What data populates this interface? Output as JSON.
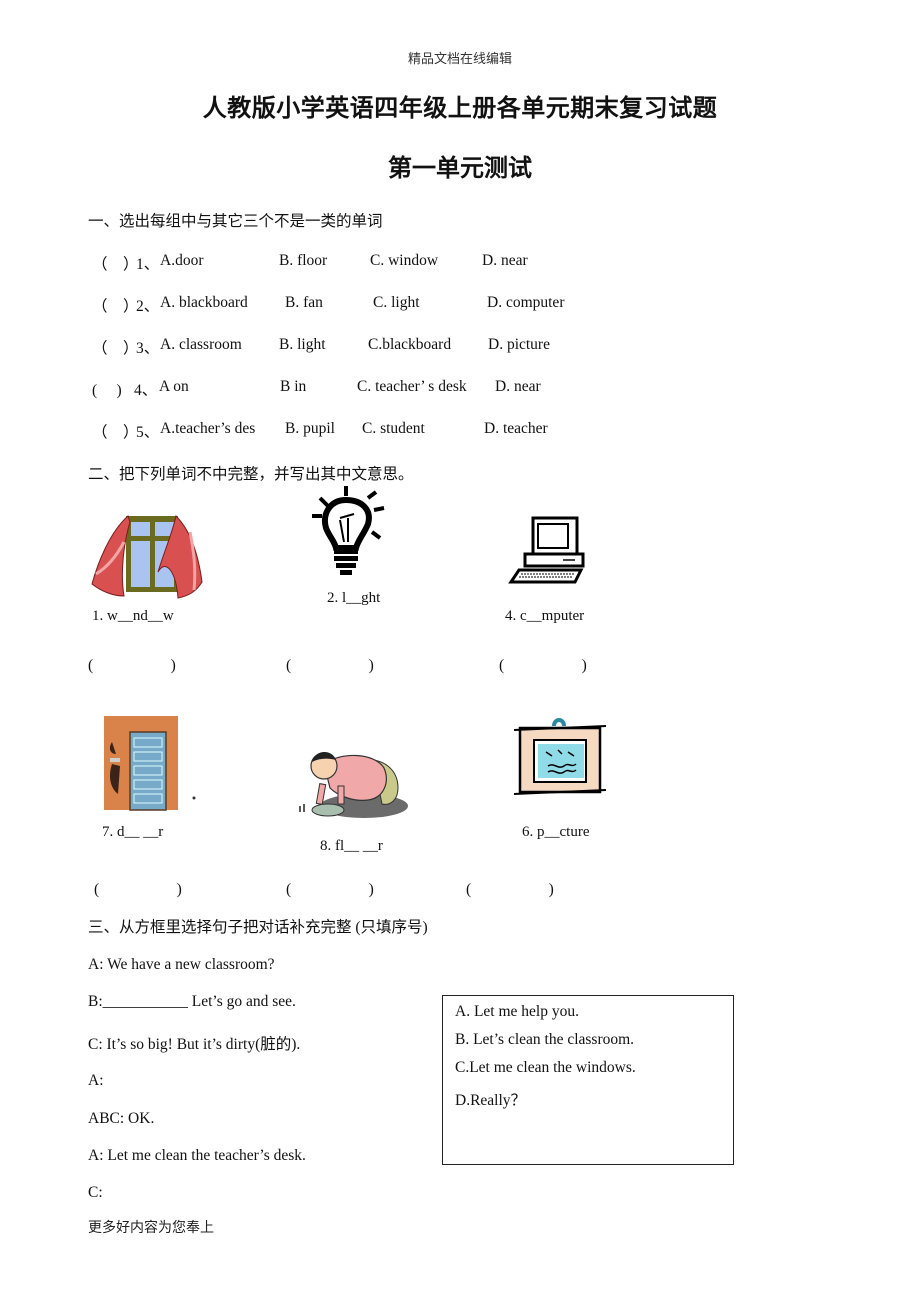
{
  "header_note": "精品文档在线编辑",
  "title": "人教版小学英语四年级上册各单元期末复习试题",
  "unit_title": "第一单元测试",
  "section1": {
    "heading": "一、选出每组中与其它三个不是一类的单词",
    "questions": [
      {
        "bracket": "（　）",
        "num": "1、",
        "a": "A.door",
        "b": "B. floor",
        "c": "C. window",
        "d": "D. near"
      },
      {
        "bracket": "（　）",
        "num": "2、",
        "a": "A. blackboard",
        "b": "B. fan",
        "c": "C. light",
        "d": "D. computer"
      },
      {
        "bracket": "（　）",
        "num": "3、",
        "a": "A. classroom",
        "b": "B. light",
        "c": "C.blackboard",
        "d": "D. picture"
      },
      {
        "bracket": "(　 )",
        "num": "4、",
        "a": "A on",
        "b": "B in",
        "c": "C. teacher’ s desk",
        "d": "D. near"
      },
      {
        "bracket": "（　）",
        "num": "5、",
        "a": "A.teacher’s des",
        "b": "B. pupil",
        "c": "C. student",
        "d": "D. teacher"
      }
    ]
  },
  "section2": {
    "heading": "二、把下列单词不中完整，并写出其中文意思。",
    "items": [
      {
        "label": "1. w__nd__w",
        "picture": "window-picture",
        "answer_blank": "(　　　　　)"
      },
      {
        "label": "2. l__ght",
        "picture": "light-bulb-picture",
        "answer_blank": "(　　　　　)"
      },
      {
        "label": "4. c__mputer",
        "picture": "computer-picture",
        "answer_blank": "(　　　　　)"
      },
      {
        "label": "7. d__ __r",
        "picture": "door-picture",
        "answer_blank": "(　　　　　)"
      },
      {
        "label": "8. fl__ __r",
        "picture": "floor-cleaning-picture",
        "answer_blank": "(　　　　　)"
      },
      {
        "label": "6. p__cture",
        "picture": "picture-frame-picture",
        "answer_blank": "(　　　　　)"
      }
    ]
  },
  "section3": {
    "heading": "三、从方框里选择句子把对话补充完整 (只填序号)",
    "dialogue": [
      "A: We have a new classroom?",
      "B:___________  Let’s go and see.",
      "C: It’s so big! But it’s dirty(脏的).",
      "A:",
      "ABC: OK.",
      "A: Let me clean the teacher’s desk.",
      "C:"
    ],
    "options": [
      "A. Let me help you.",
      "B. Let’s clean the classroom.",
      "C.Let me clean the windows.",
      "D.Really？"
    ]
  },
  "footer": "更多好内容为您奉上"
}
